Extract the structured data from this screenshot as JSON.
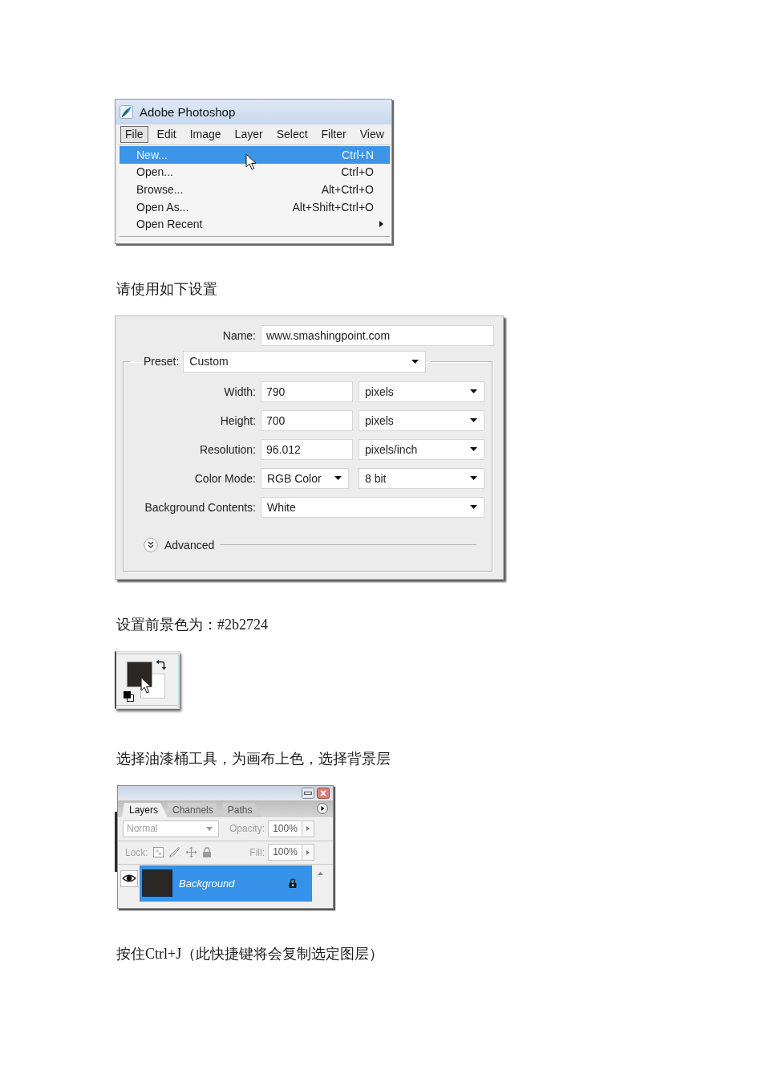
{
  "content": [
    {
      "kind": "menu_screenshot",
      "title": "Adobe Photoshop",
      "menu_bar": [
        {
          "label": "File",
          "selected": true
        },
        {
          "label": "Edit",
          "selected": false
        },
        {
          "label": "Image",
          "selected": false
        },
        {
          "label": "Layer",
          "selected": false
        },
        {
          "label": "Select",
          "selected": false
        },
        {
          "label": "Filter",
          "selected": false
        },
        {
          "label": "View",
          "selected": false
        }
      ],
      "menu_items": [
        {
          "label": "New...",
          "shortcut": "Ctrl+N",
          "selected": true,
          "submenu": false
        },
        {
          "label": "Open...",
          "shortcut": "Ctrl+O",
          "selected": false,
          "submenu": false
        },
        {
          "label": "Browse...",
          "shortcut": "Alt+Ctrl+O",
          "selected": false,
          "submenu": false
        },
        {
          "label": "Open As...",
          "shortcut": "Alt+Shift+Ctrl+O",
          "selected": false,
          "submenu": false
        },
        {
          "label": "Open Recent",
          "selected": false,
          "submenu": true
        }
      ]
    },
    {
      "kind": "paragraph",
      "text": "请使用如下设置"
    },
    {
      "kind": "new_document_dialog",
      "name": {
        "label": "Name:",
        "value": "www.smashingpoint.com"
      },
      "preset": {
        "label": "Preset:",
        "value": "Custom"
      },
      "rows": [
        {
          "kind": "input_unit",
          "label": "Width:",
          "value": "790",
          "unit": "pixels"
        },
        {
          "kind": "input_unit",
          "label": "Height:",
          "value": "700",
          "unit": "pixels"
        },
        {
          "kind": "input_unit",
          "label": "Resolution:",
          "value": "96.012",
          "unit": "pixels/inch"
        },
        {
          "kind": "select_pair",
          "label": "Color Mode:",
          "value": "RGB Color",
          "value_2": "8 bit"
        },
        {
          "kind": "select",
          "label": "Background Contents:",
          "value": "White"
        }
      ],
      "advanced": {
        "label": "Advanced",
        "expanded": false
      }
    },
    {
      "kind": "paragraph",
      "text": "设置前景色为：#2b2724"
    },
    {
      "kind": "color_swatches",
      "swatches": [
        {
          "kind": "background",
          "color": "#ffffff"
        },
        {
          "kind": "foreground",
          "color": "#2b2724"
        }
      ]
    },
    {
      "kind": "paragraph",
      "text": "选择油漆桶工具，为画布上色，选择背景层"
    },
    {
      "kind": "layers_panel",
      "tabs": [
        {
          "label": "Layers",
          "selected": true
        },
        {
          "label": "Channels",
          "selected": false
        },
        {
          "label": "Paths",
          "selected": false
        }
      ],
      "blend_mode": {
        "value": "Normal",
        "disabled": true
      },
      "opacity": {
        "label": "Opacity:",
        "value": "100%",
        "disabled": true
      },
      "lock": {
        "label": "Lock:",
        "disabled": true
      },
      "fill": {
        "label": "Fill:",
        "value": "100%",
        "disabled": true
      },
      "layers": [
        {
          "name": "Background",
          "selected": true,
          "visible": true,
          "locked": true,
          "color": "#2b2724"
        }
      ]
    },
    {
      "kind": "paragraph",
      "text": "按住Ctrl+J（此快捷键将会复制选定图层）"
    }
  ]
}
